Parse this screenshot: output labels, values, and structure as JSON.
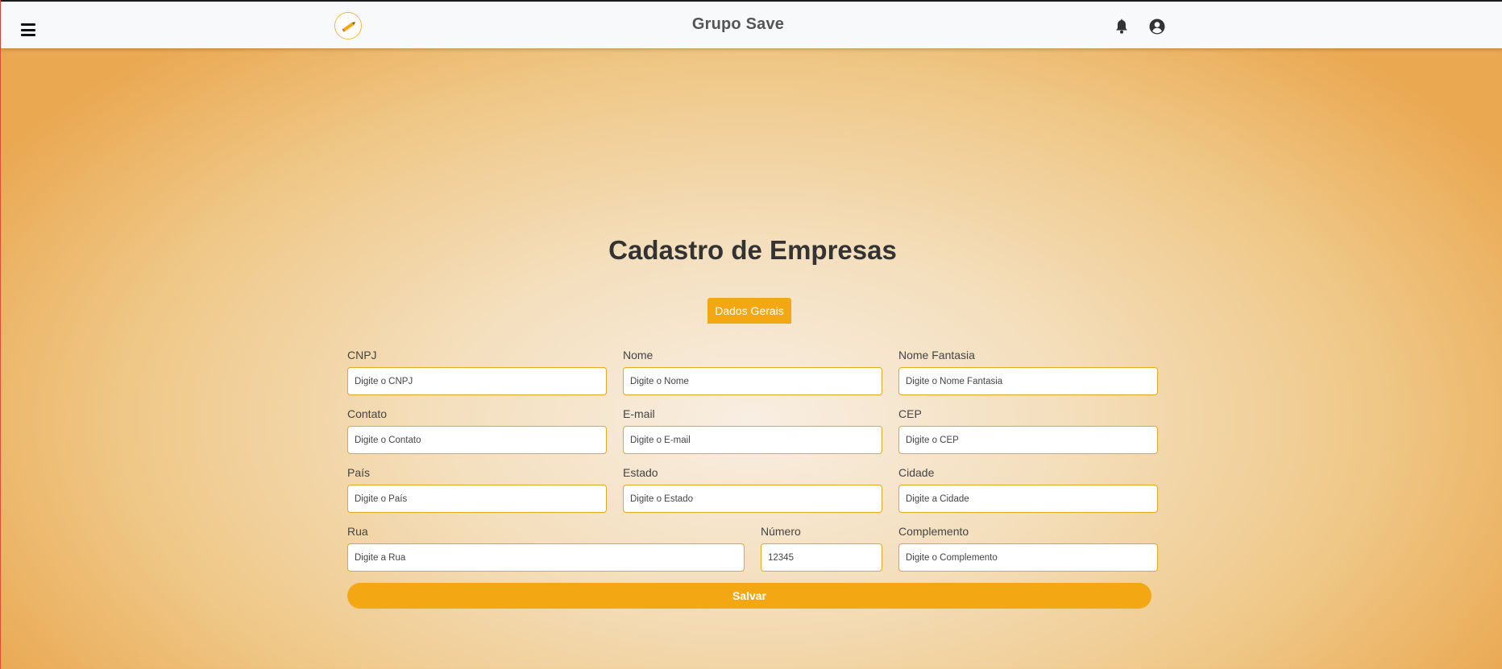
{
  "header": {
    "title": "Grupo Save",
    "menu_icon": "hamburger-menu-icon",
    "logo": "pencil-logo",
    "notification_icon": "bell-icon",
    "account_icon": "user-circle-icon"
  },
  "page": {
    "title": "Cadastro de Empresas",
    "tab_label": "Dados Gerais"
  },
  "form": {
    "cnpj": {
      "label": "CNPJ",
      "placeholder": "Digite o CNPJ"
    },
    "nome": {
      "label": "Nome",
      "placeholder": "Digite o Nome"
    },
    "nome_fantasia": {
      "label": "Nome Fantasia",
      "placeholder": "Digite o Nome Fantasia"
    },
    "contato": {
      "label": "Contato",
      "placeholder": "Digite o Contato"
    },
    "email": {
      "label": "E-mail",
      "placeholder": "Digite o E-mail"
    },
    "cep": {
      "label": "CEP",
      "placeholder": "Digite o CEP"
    },
    "pais": {
      "label": "País",
      "placeholder": "Digite o País"
    },
    "estado": {
      "label": "Estado",
      "placeholder": "Digite o Estado"
    },
    "cidade": {
      "label": "Cidade",
      "placeholder": "Digite a Cidade"
    },
    "rua": {
      "label": "Rua",
      "placeholder": "Digite a Rua"
    },
    "numero": {
      "label": "Número",
      "placeholder": "12345"
    },
    "complemento": {
      "label": "Complemento",
      "placeholder": "Digite o Complemento"
    },
    "save_label": "Salvar"
  },
  "colors": {
    "accent": "#f3a712",
    "input_border": "#e5a820",
    "title_text": "#333333"
  }
}
